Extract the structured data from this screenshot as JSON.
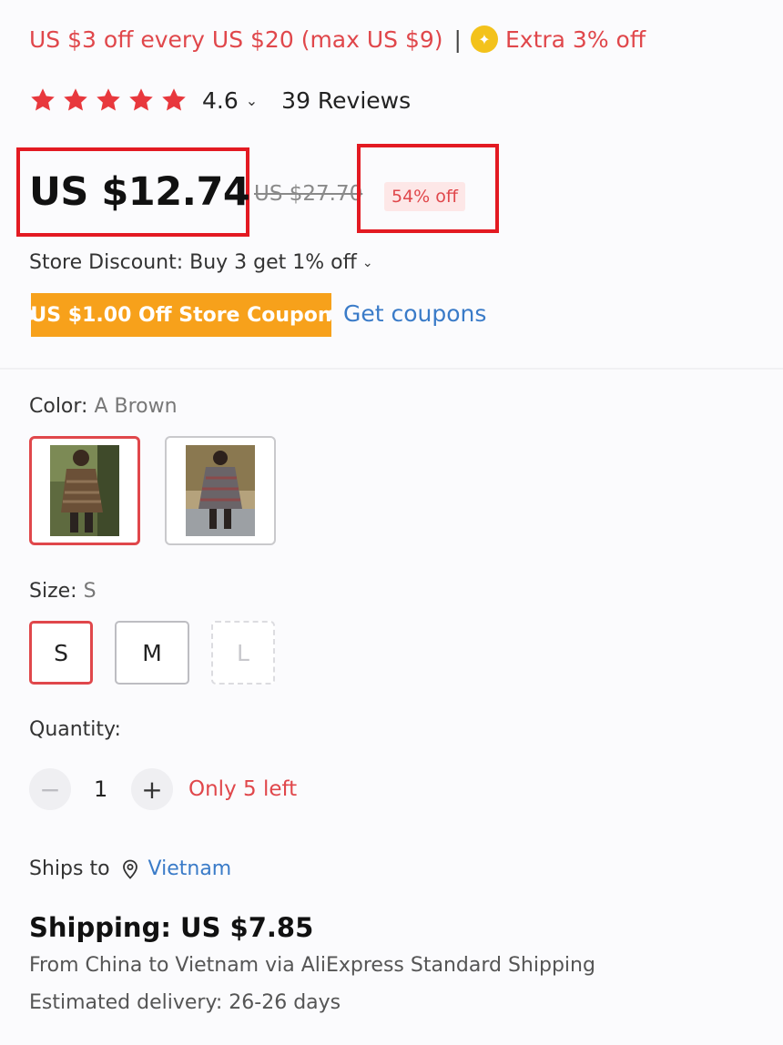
{
  "promo": {
    "text": "US $3 off every US $20 (max US $9)",
    "separator": "|",
    "extra_text": "Extra 3% off",
    "coin_icon": "coin-icon"
  },
  "rating": {
    "stars_filled": 5,
    "score": "4.6",
    "reviews": "39 Reviews",
    "star_color": "#e8383d"
  },
  "price": {
    "current": "US $12.74",
    "original": "US $27.70",
    "discount": "54% off"
  },
  "store_discount": "Store Discount: Buy 3 get 1% off",
  "coupon": {
    "label": "US $1.00 Off Store Coupon",
    "link": "Get coupons"
  },
  "color": {
    "label": "Color: ",
    "value": "A Brown",
    "options": [
      "A Brown",
      "B"
    ],
    "selected": 0
  },
  "size": {
    "label": "Size: ",
    "value": "S",
    "options": [
      {
        "label": "S",
        "state": "selected"
      },
      {
        "label": "M",
        "state": "available"
      },
      {
        "label": "L",
        "state": "disabled"
      }
    ]
  },
  "quantity": {
    "label": "Quantity:",
    "minus": "−",
    "value": "1",
    "plus": "+",
    "stock": "Only 5 left"
  },
  "ships_to": {
    "label": "Ships to",
    "country": "Vietnam"
  },
  "shipping": {
    "title": "Shipping: US $7.85",
    "route": "From China to Vietnam via AliExpress Standard Shipping",
    "delivery": "Estimated delivery: 26-26 days"
  },
  "colors": {
    "accent": "#e0474b",
    "link": "#3a7bc8",
    "coupon": "#f7a11b",
    "highlight_box": "#e31a22"
  }
}
